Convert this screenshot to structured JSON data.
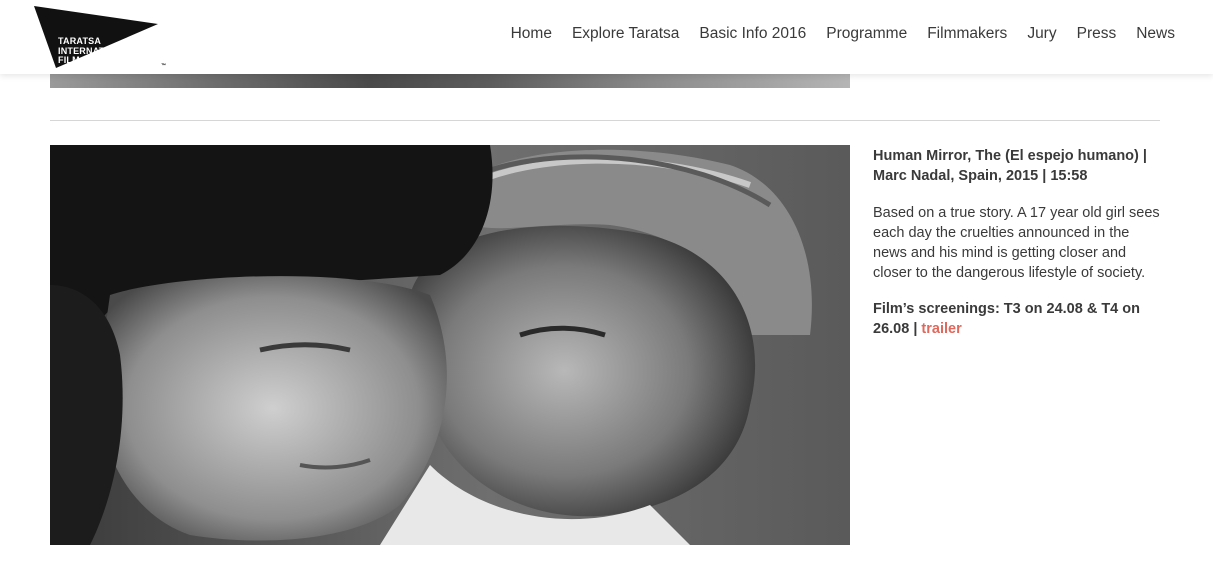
{
  "header": {
    "logo": {
      "lines": [
        "TARATSA",
        "INTERNATIONAL",
        "FILM FESTIVAL"
      ],
      "trademark": "™"
    },
    "nav": [
      {
        "label": "Home"
      },
      {
        "label": "Explore Taratsa"
      },
      {
        "label": "Basic Info 2016"
      },
      {
        "label": "Programme"
      },
      {
        "label": "Filmmakers"
      },
      {
        "label": "Jury"
      },
      {
        "label": "Press"
      },
      {
        "label": "News"
      }
    ]
  },
  "film": {
    "title": "Human Mirror, The (El espejo humano) | Marc Nadal, Spain, 2015 | 15:58",
    "description": "Based on a true story. A 17 year old girl sees each day the cruelties announced in the news and his mind is getting closer and closer to the dangerous lifestyle of society.",
    "screenings": "Film’s screenings: T3 on 24.08 & T4 on 26.08 |",
    "trailer_label": "trailer"
  },
  "colors": {
    "accent": "#e0685c",
    "text": "#3a3a3a",
    "divider": "#d6d6d6"
  }
}
